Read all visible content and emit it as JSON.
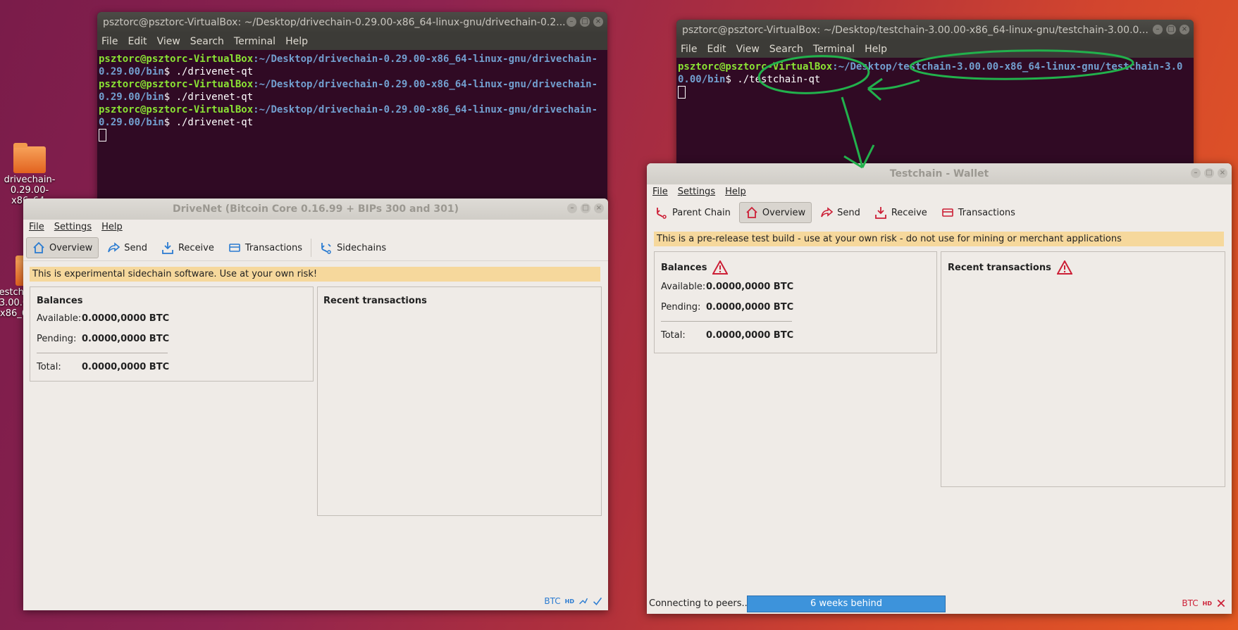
{
  "desktop": {
    "icons": [
      {
        "label": "drivechain-0.29.00-x86_64-linux-gnu"
      },
      {
        "label": "testchain-3.00.00-x86_64-linux-gnu"
      }
    ]
  },
  "terminal1": {
    "title": "psztorc@psztorc-VirtualBox: ~/Desktop/drivechain-0.29.00-x86_64-linux-gnu/drivechain-0.2...",
    "menu": [
      "File",
      "Edit",
      "View",
      "Search",
      "Terminal",
      "Help"
    ],
    "prompt_user": "psztorc@psztorc-VirtualBox",
    "prompt_path": "~/Desktop/drivechain-0.29.00-x86_64-linux-gnu/drivechain-0.29.00/bin",
    "command": "./drivenet-qt"
  },
  "terminal2": {
    "title": "psztorc@psztorc-VirtualBox: ~/Desktop/testchain-3.00.00-x86_64-linux-gnu/testchain-3.00.0...",
    "menu": [
      "File",
      "Edit",
      "View",
      "Search",
      "Terminal",
      "Help"
    ],
    "prompt_user": "psztorc@psztorc-VirtualBox",
    "prompt_path": "~/Desktop/testchain-3.00.00-x86_64-linux-gnu/testchain-3.00.00/bin",
    "command": "./testchain-qt"
  },
  "drivenet": {
    "title": "DriveNet   (Bitcoin Core 0.16.99 + BIPs 300 and 301)",
    "menu": [
      "File",
      "Settings",
      "Help"
    ],
    "tabs": [
      "Overview",
      "Send",
      "Receive",
      "Transactions",
      "Sidechains"
    ],
    "banner": "This is experimental sidechain software.  Use at your own risk!",
    "balances_title": "Balances",
    "available_label": "Available:",
    "available_value": "0.0000,0000 BTC",
    "pending_label": "Pending:",
    "pending_value": "0.0000,0000 BTC",
    "total_label": "Total:",
    "total_value": "0.0000,0000 BTC",
    "recent_title": "Recent transactions",
    "status_unit": "BTC",
    "status_hd": "HD"
  },
  "testchain": {
    "title": "Testchain - Wallet",
    "menu": [
      "File",
      "Settings",
      "Help"
    ],
    "tabs": [
      "Parent Chain",
      "Overview",
      "Send",
      "Receive",
      "Transactions"
    ],
    "banner": "This is a pre-release test build - use at your own risk - do not use for mining or merchant applications",
    "balances_title": "Balances",
    "available_label": "Available:",
    "available_value": "0.0000,0000 BTC",
    "pending_label": "Pending:",
    "pending_value": "0.0000,0000 BTC",
    "total_label": "Total:",
    "total_value": "0.0000,0000 BTC",
    "recent_title": "Recent transactions",
    "status_text": "Connecting to peers...",
    "progress_text": "6 weeks behind",
    "status_unit": "BTC",
    "status_hd": "HD"
  },
  "colors": {
    "terminal_bg": "#300a24",
    "prompt_user": "#8ae234",
    "prompt_path": "#729fcf",
    "warning_banner": "#f6d89c",
    "annotation": "#22b14c",
    "progress": "#3d93db",
    "error_red": "#cc1f36"
  }
}
